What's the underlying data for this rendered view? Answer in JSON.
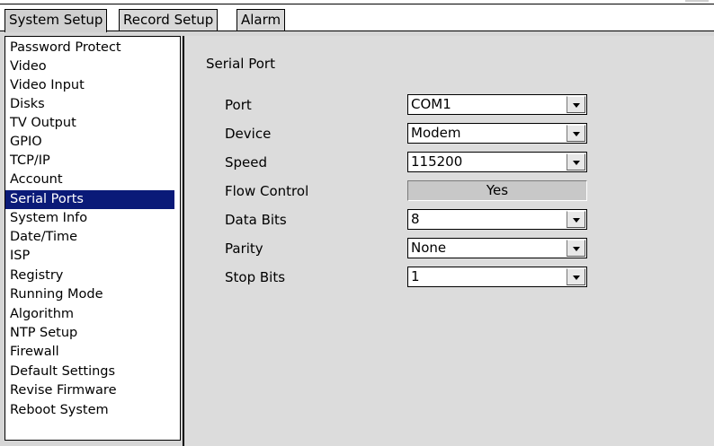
{
  "tabs": [
    {
      "label": "System Setup",
      "active": true
    },
    {
      "label": "Record Setup",
      "active": false
    },
    {
      "label": "Alarm",
      "active": false
    }
  ],
  "sidebar": {
    "items": [
      {
        "label": "Password Protect"
      },
      {
        "label": "Video"
      },
      {
        "label": "Video Input"
      },
      {
        "label": "Disks"
      },
      {
        "label": "TV Output"
      },
      {
        "label": "GPIO"
      },
      {
        "label": "TCP/IP"
      },
      {
        "label": "Account"
      },
      {
        "label": "Serial Ports",
        "selected": true
      },
      {
        "label": "System Info"
      },
      {
        "label": "Date/Time"
      },
      {
        "label": "ISP"
      },
      {
        "label": "Registry"
      },
      {
        "label": "Running Mode"
      },
      {
        "label": "Algorithm"
      },
      {
        "label": "NTP Setup"
      },
      {
        "label": "Firewall"
      },
      {
        "label": "Default Settings"
      },
      {
        "label": "Revise Firmware"
      },
      {
        "label": "Reboot System"
      }
    ]
  },
  "main": {
    "section_title": "Serial Port",
    "fields": {
      "port": {
        "label": "Port",
        "value": "COM1"
      },
      "device": {
        "label": "Device",
        "value": "Modem"
      },
      "speed": {
        "label": "Speed",
        "value": "115200"
      },
      "flow_control": {
        "label": "Flow Control",
        "value": "Yes"
      },
      "data_bits": {
        "label": "Data Bits",
        "value": "8"
      },
      "parity": {
        "label": "Parity",
        "value": "None"
      },
      "stop_bits": {
        "label": "Stop Bits",
        "value": "1"
      }
    }
  },
  "colors": {
    "selected_bg": "#0a1a78",
    "panel_bg": "#dcdcdc"
  },
  "icons": {
    "dropdown": "chevron-down-icon"
  }
}
